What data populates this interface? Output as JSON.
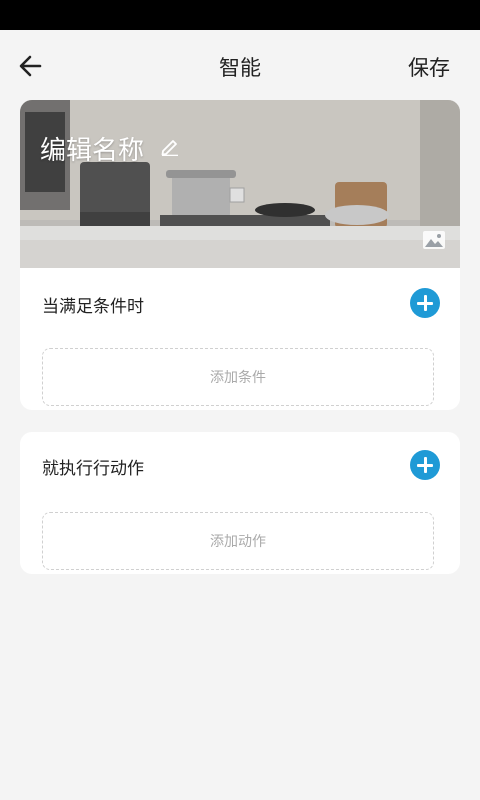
{
  "header": {
    "title": "智能",
    "save_label": "保存",
    "back_icon": "arrow-left-icon"
  },
  "scene": {
    "name": "编辑名称",
    "edit_icon": "pencil-icon",
    "change_image_icon": "image-icon"
  },
  "condition_section": {
    "label": "当满足条件时",
    "add_icon": "plus-circle-icon",
    "placeholder": "添加条件"
  },
  "action_section": {
    "label": "就执行行动作",
    "add_icon": "plus-circle-icon",
    "placeholder": "添加动作"
  },
  "colors": {
    "accent": "#1f9ad6",
    "background": "#f4f4f4",
    "card": "#ffffff"
  }
}
